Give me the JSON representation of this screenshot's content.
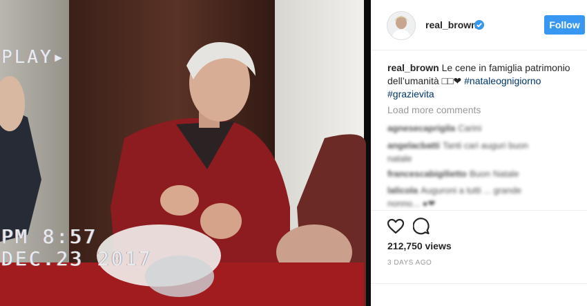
{
  "video": {
    "overlay_play": "PLAY▸",
    "overlay_time": "PM 8:57",
    "overlay_date": "DEC.23 2017"
  },
  "post": {
    "username": "real_brown",
    "follow_label": "Follow",
    "caption_user": "real_brown",
    "caption_text": "Le cene in famiglia patrimonio dell’umanità □□❤",
    "hashtag_1": "#nataleognigiorno",
    "hashtag_2": "#grazievita",
    "load_more": "Load more comments",
    "comments": [
      {
        "user": "agnesecaprigila",
        "text": "Carini"
      },
      {
        "user": "angelacbatti",
        "text": "Tanti cari auguri buon natale"
      },
      {
        "user": "francescabigilietto",
        "text": "Buon Natale"
      },
      {
        "user": "lalicola",
        "text": "Auguroni a tutti ... grande nonno... ●❤"
      }
    ],
    "views": "212,750 views",
    "time_ago": "3 DAYS AGO"
  },
  "colors": {
    "accent": "#3897f0",
    "text": "#262626",
    "muted": "#999999",
    "hashtag": "#003569"
  },
  "icons": [
    "verified-badge-icon",
    "heart-icon",
    "comment-icon"
  ]
}
